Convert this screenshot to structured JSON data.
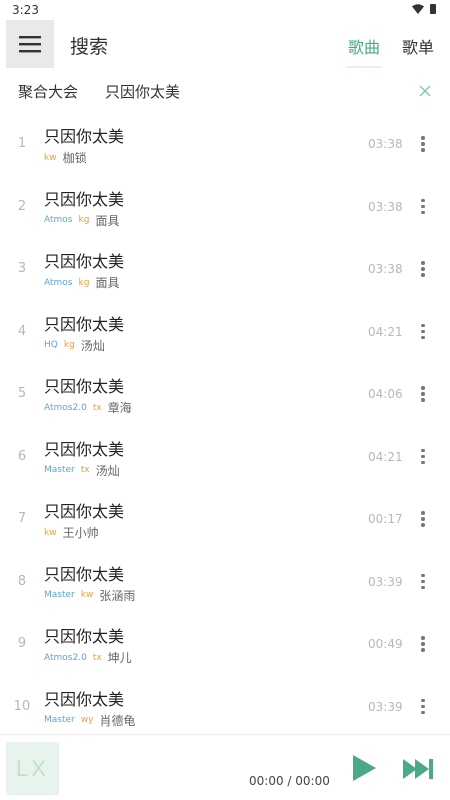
{
  "status_bar": {
    "time": "3:23"
  },
  "header": {
    "title": "搜索",
    "tabs": [
      {
        "label": "歌曲",
        "active": true
      },
      {
        "label": "歌单",
        "active": false
      }
    ]
  },
  "search": {
    "source": "聚合大会",
    "query": "只因你太美"
  },
  "songs": [
    {
      "index": "1",
      "title": "只因你太美",
      "quality": "",
      "source": "kw",
      "artist": "枷锁",
      "duration": "03:38"
    },
    {
      "index": "2",
      "title": "只因你太美",
      "quality": "Atmos",
      "source": "kg",
      "artist": "面具",
      "duration": "03:38"
    },
    {
      "index": "3",
      "title": "只因你太美",
      "quality": "Atmos",
      "source": "kg",
      "artist": "面具",
      "duration": "03:38"
    },
    {
      "index": "4",
      "title": "只因你太美",
      "quality": "HQ",
      "source": "kg",
      "artist": "汤灿",
      "duration": "04:21"
    },
    {
      "index": "5",
      "title": "只因你太美",
      "quality": "Atmos2.0",
      "source": "tx",
      "artist": "章海",
      "duration": "04:06"
    },
    {
      "index": "6",
      "title": "只因你太美",
      "quality": "Master",
      "source": "tx",
      "artist": "汤灿",
      "duration": "04:21"
    },
    {
      "index": "7",
      "title": "只因你太美",
      "quality": "",
      "source": "kw",
      "artist": "王小帅",
      "duration": "00:17"
    },
    {
      "index": "8",
      "title": "只因你太美",
      "quality": "Master",
      "source": "kw",
      "artist": "张涵雨",
      "duration": "03:39"
    },
    {
      "index": "9",
      "title": "只因你太美",
      "quality": "Atmos2.0",
      "source": "tx",
      "artist": "坤儿",
      "duration": "00:49"
    },
    {
      "index": "10",
      "title": "只因你太美",
      "quality": "Master",
      "source": "wy",
      "artist": "肖德龟",
      "duration": "03:39"
    }
  ],
  "player": {
    "cover_text": "LX",
    "progress": "00:00 / 00:00"
  },
  "colors": {
    "accent": "#4aa987",
    "quality": "#5aa6d6",
    "source": "#e6a23c"
  },
  "icons": {
    "menu": "menu-icon",
    "clear": "close-icon",
    "more": "more-vertical-icon",
    "play": "play-icon",
    "next": "skip-next-icon"
  }
}
